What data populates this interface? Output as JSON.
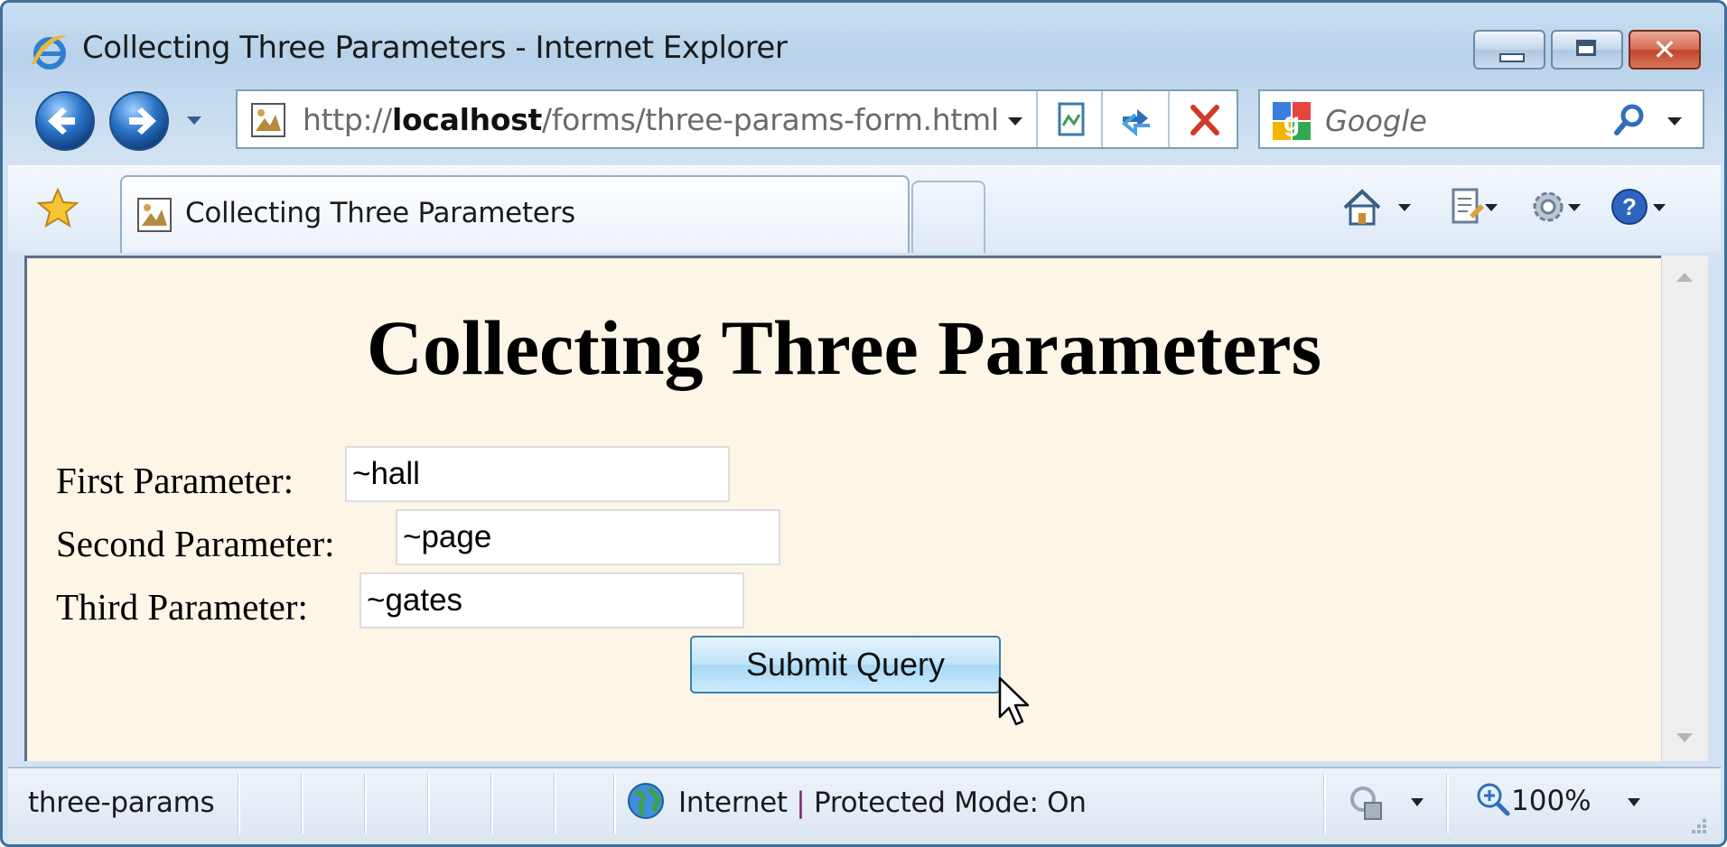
{
  "window": {
    "title": "Collecting Three Parameters - Internet Explorer"
  },
  "address_bar": {
    "url_prefix": "http://",
    "url_host": "localhost",
    "url_path": "/forms/three-params-form.html"
  },
  "search": {
    "placeholder": "Google"
  },
  "tabs": [
    {
      "label": "Collecting Three Parameters",
      "active": true
    }
  ],
  "page": {
    "heading": "Collecting Three Parameters",
    "fields": [
      {
        "label": "First Parameter:",
        "value": "~hall"
      },
      {
        "label": "Second Parameter:",
        "value": "~page"
      },
      {
        "label": "Third Parameter:",
        "value": "~gates"
      }
    ],
    "submit_label": "Submit Query"
  },
  "status_bar": {
    "text": "three-params",
    "zone_name": "Internet",
    "zone_separator": "|",
    "protected_mode": "Protected Mode: On",
    "zoom": "100%"
  },
  "icons": {
    "back": "back-arrow-icon",
    "forward": "forward-arrow-icon",
    "compatibility": "compatibility-view-icon",
    "refresh": "refresh-icon",
    "stop": "stop-icon",
    "search": "search-icon",
    "favorites": "favorites-star-icon",
    "home": "home-icon",
    "page": "page-icon",
    "tools": "tools-gear-icon",
    "help": "help-icon",
    "globe": "globe-icon",
    "security": "security-lock-icon",
    "zoom": "zoom-icon"
  },
  "colors": {
    "page_background": "#fdf5e6",
    "frame": "#3f6f9a",
    "close_button": "#c2432b"
  }
}
